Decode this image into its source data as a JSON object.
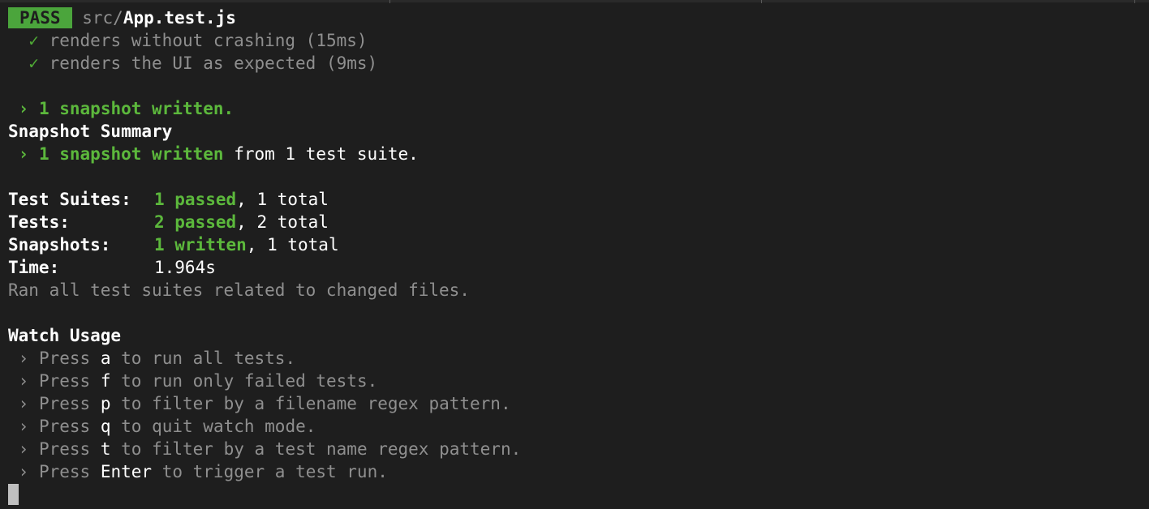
{
  "header": {
    "badge": "PASS",
    "path_dir": "src/",
    "path_file": "App.test.js"
  },
  "tests": [
    {
      "check": "✓",
      "text": "renders without crashing (15ms)"
    },
    {
      "check": "✓",
      "text": "renders the UI as expected (9ms)"
    }
  ],
  "snapshot_written": {
    "arrow": "›",
    "text": "1 snapshot written."
  },
  "snapshot_summary": {
    "title": "Snapshot Summary",
    "arrow": "›",
    "written": "1 snapshot written",
    "suffix": " from 1 test suite."
  },
  "summary": {
    "suites_label": "Test Suites:",
    "suites_passed": "1 passed",
    "suites_total": ", 1 total",
    "tests_label": "Tests:",
    "tests_passed": "2 passed",
    "tests_total": ", 2 total",
    "snapshots_label": "Snapshots:",
    "snapshots_written": "1 written",
    "snapshots_total": ", 1 total",
    "time_label": "Time:",
    "time_value": "1.964s",
    "ran_all": "Ran all test suites related to changed files."
  },
  "watch_usage": {
    "title": "Watch Usage",
    "items": [
      {
        "arrow": "›",
        "press": "Press",
        "key": "a",
        "action": "to run all tests."
      },
      {
        "arrow": "›",
        "press": "Press",
        "key": "f",
        "action": "to run only failed tests."
      },
      {
        "arrow": "›",
        "press": "Press",
        "key": "p",
        "action": "to filter by a filename regex pattern."
      },
      {
        "arrow": "›",
        "press": "Press",
        "key": "q",
        "action": "to quit watch mode."
      },
      {
        "arrow": "›",
        "press": "Press",
        "key": "t",
        "action": "to filter by a test name regex pattern."
      },
      {
        "arrow": "›",
        "press": "Press",
        "key": "Enter",
        "action": "to trigger a test run."
      }
    ]
  },
  "colors": {
    "background": "#1e1e1e",
    "pass_badge": "#4ba53c",
    "green": "#5cb83c",
    "dim": "#8f8f8f"
  }
}
